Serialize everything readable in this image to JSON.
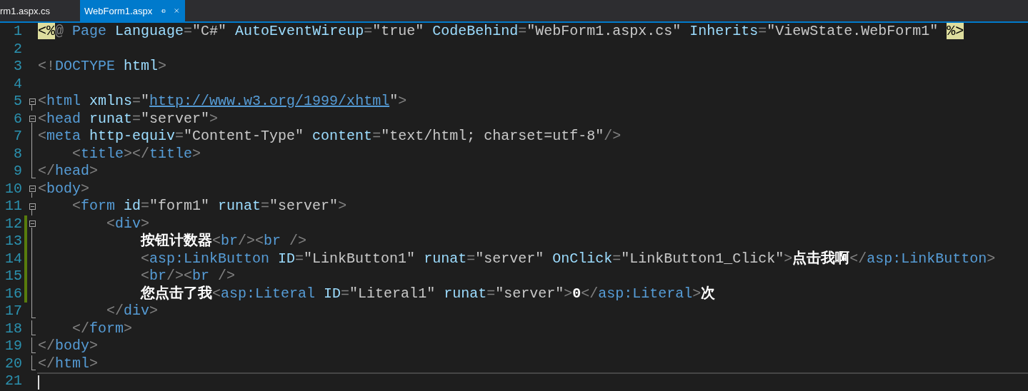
{
  "tabs": [
    {
      "label": "rm1.aspx.cs",
      "selected": false
    },
    {
      "label": "WebForm1.aspx",
      "selected": true
    }
  ],
  "lines": [
    {
      "number": "1",
      "kind": "none",
      "changed": false,
      "current": false,
      "tokens": [
        {
          "kind": "directive",
          "text": "<%"
        },
        {
          "kind": "punct",
          "text": "@"
        },
        {
          "kind": "tag",
          "text": " Page"
        },
        {
          "kind": "attr",
          "text": " Language"
        },
        {
          "kind": "punct",
          "text": "="
        },
        {
          "kind": "string",
          "text": "\"C#\""
        },
        {
          "kind": "attr",
          "text": " AutoEventWireup"
        },
        {
          "kind": "punct",
          "text": "="
        },
        {
          "kind": "string",
          "text": "\"true\""
        },
        {
          "kind": "attr",
          "text": " CodeBehind"
        },
        {
          "kind": "punct",
          "text": "="
        },
        {
          "kind": "string",
          "text": "\"WebForm1.aspx.cs\""
        },
        {
          "kind": "attr",
          "text": " Inherits"
        },
        {
          "kind": "punct",
          "text": "="
        },
        {
          "kind": "string",
          "text": "\"ViewState.WebForm1\" "
        },
        {
          "kind": "directive",
          "text": "%>"
        }
      ]
    },
    {
      "number": "2",
      "kind": "none",
      "changed": false,
      "current": false
    },
    {
      "number": "3",
      "kind": "none",
      "changed": false,
      "current": false,
      "tokens": [
        {
          "kind": "punct",
          "text": "<!"
        },
        {
          "kind": "tag",
          "text": "DOCTYPE"
        },
        {
          "kind": "attr",
          "text": " html"
        },
        {
          "kind": "punct",
          "text": ">"
        }
      ]
    },
    {
      "number": "4",
      "kind": "none",
      "changed": false,
      "current": false
    },
    {
      "number": "5",
      "kind": "start",
      "changed": false,
      "current": false,
      "tokens": [
        {
          "kind": "punct",
          "text": "<"
        },
        {
          "kind": "tag",
          "text": "html"
        },
        {
          "kind": "attr",
          "text": " xmlns"
        },
        {
          "kind": "punct",
          "text": "="
        },
        {
          "kind": "string",
          "text": "\""
        },
        {
          "kind": "url",
          "text": "http://www.w3.org/1999/xhtml"
        },
        {
          "kind": "string",
          "text": "\""
        },
        {
          "kind": "punct",
          "text": ">"
        }
      ]
    },
    {
      "number": "6",
      "kind": "start",
      "changed": false,
      "current": false,
      "tokens": [
        {
          "kind": "punct",
          "text": "<"
        },
        {
          "kind": "tag",
          "text": "head"
        },
        {
          "kind": "attr",
          "text": " runat"
        },
        {
          "kind": "punct",
          "text": "="
        },
        {
          "kind": "string",
          "text": "\"server\""
        },
        {
          "kind": "punct",
          "text": ">"
        }
      ]
    },
    {
      "number": "7",
      "kind": "middle",
      "changed": false,
      "current": false,
      "tokens": [
        {
          "kind": "punct",
          "text": "<"
        },
        {
          "kind": "tag",
          "text": "meta"
        },
        {
          "kind": "attr",
          "text": " http-equiv"
        },
        {
          "kind": "punct",
          "text": "="
        },
        {
          "kind": "string",
          "text": "\"Content-Type\""
        },
        {
          "kind": "attr",
          "text": " content"
        },
        {
          "kind": "punct",
          "text": "="
        },
        {
          "kind": "string",
          "text": "\"text/html; charset=utf-8\""
        },
        {
          "kind": "punct",
          "text": "/>"
        }
      ]
    },
    {
      "number": "8",
      "kind": "middle",
      "changed": false,
      "current": false,
      "tokens": [
        {
          "kind": "punct",
          "text": "    <"
        },
        {
          "kind": "tag",
          "text": "title"
        },
        {
          "kind": "punct",
          "text": "></"
        },
        {
          "kind": "tag",
          "text": "title"
        },
        {
          "kind": "punct",
          "text": ">"
        }
      ]
    },
    {
      "number": "9",
      "kind": "end",
      "changed": false,
      "current": false,
      "tokens": [
        {
          "kind": "punct",
          "text": "</"
        },
        {
          "kind": "tag",
          "text": "head"
        },
        {
          "kind": "punct",
          "text": ">"
        }
      ]
    },
    {
      "number": "10",
      "kind": "start",
      "changed": false,
      "current": false,
      "tokens": [
        {
          "kind": "punct",
          "text": "<"
        },
        {
          "kind": "tag",
          "text": "body"
        },
        {
          "kind": "punct",
          "text": ">"
        }
      ]
    },
    {
      "number": "11",
      "kind": "start",
      "changed": false,
      "current": false,
      "tokens": [
        {
          "kind": "punct",
          "text": "    <"
        },
        {
          "kind": "tag",
          "text": "form"
        },
        {
          "kind": "attr",
          "text": " id"
        },
        {
          "kind": "punct",
          "text": "="
        },
        {
          "kind": "string",
          "text": "\"form1\""
        },
        {
          "kind": "attr",
          "text": " runat"
        },
        {
          "kind": "punct",
          "text": "="
        },
        {
          "kind": "string",
          "text": "\"server\""
        },
        {
          "kind": "punct",
          "text": ">"
        }
      ]
    },
    {
      "number": "12",
      "kind": "start",
      "changed": true,
      "current": false,
      "tokens": [
        {
          "kind": "punct",
          "text": "        <"
        },
        {
          "kind": "tag",
          "text": "div"
        },
        {
          "kind": "punct",
          "text": ">"
        }
      ]
    },
    {
      "number": "13",
      "kind": "middle",
      "changed": true,
      "current": false,
      "tokens": [
        {
          "kind": "text",
          "text": "            按钮计数器"
        },
        {
          "kind": "punct",
          "text": "<"
        },
        {
          "kind": "tag",
          "text": "br"
        },
        {
          "kind": "punct",
          "text": "/><"
        },
        {
          "kind": "tag",
          "text": "br"
        },
        {
          "kind": "punct",
          "text": " />"
        }
      ]
    },
    {
      "number": "14",
      "kind": "middle",
      "changed": true,
      "current": false,
      "tokens": [
        {
          "kind": "punct",
          "text": "            <"
        },
        {
          "kind": "tag",
          "text": "asp:LinkButton"
        },
        {
          "kind": "attr",
          "text": " ID"
        },
        {
          "kind": "punct",
          "text": "="
        },
        {
          "kind": "string",
          "text": "\"LinkButton1\""
        },
        {
          "kind": "attr",
          "text": " runat"
        },
        {
          "kind": "punct",
          "text": "="
        },
        {
          "kind": "string",
          "text": "\"server\""
        },
        {
          "kind": "attr",
          "text": " OnClick"
        },
        {
          "kind": "punct",
          "text": "="
        },
        {
          "kind": "string",
          "text": "\"LinkButton1_Click\""
        },
        {
          "kind": "punct",
          "text": ">"
        },
        {
          "kind": "text",
          "text": "点击我啊"
        },
        {
          "kind": "punct",
          "text": "</"
        },
        {
          "kind": "tag",
          "text": "asp:LinkButton"
        },
        {
          "kind": "punct",
          "text": ">"
        }
      ]
    },
    {
      "number": "15",
      "kind": "middle",
      "changed": true,
      "current": false,
      "tokens": [
        {
          "kind": "punct",
          "text": "            <"
        },
        {
          "kind": "tag",
          "text": "br"
        },
        {
          "kind": "punct",
          "text": "/><"
        },
        {
          "kind": "tag",
          "text": "br"
        },
        {
          "kind": "punct",
          "text": " />"
        }
      ]
    },
    {
      "number": "16",
      "kind": "middle",
      "changed": true,
      "current": false,
      "tokens": [
        {
          "kind": "text",
          "text": "            您点击了我"
        },
        {
          "kind": "punct",
          "text": "<"
        },
        {
          "kind": "tag",
          "text": "asp:Literal"
        },
        {
          "kind": "attr",
          "text": " ID"
        },
        {
          "kind": "punct",
          "text": "="
        },
        {
          "kind": "string",
          "text": "\"Literal1\""
        },
        {
          "kind": "attr",
          "text": " runat"
        },
        {
          "kind": "punct",
          "text": "="
        },
        {
          "kind": "string",
          "text": "\"server\""
        },
        {
          "kind": "punct",
          "text": ">"
        },
        {
          "kind": "text",
          "text": "0"
        },
        {
          "kind": "punct",
          "text": "</"
        },
        {
          "kind": "tag",
          "text": "asp:Literal"
        },
        {
          "kind": "punct",
          "text": ">"
        },
        {
          "kind": "text",
          "text": "次"
        }
      ]
    },
    {
      "number": "17",
      "kind": "end",
      "changed": false,
      "current": false,
      "tokens": [
        {
          "kind": "punct",
          "text": "        </"
        },
        {
          "kind": "tag",
          "text": "div"
        },
        {
          "kind": "punct",
          "text": ">"
        }
      ]
    },
    {
      "number": "18",
      "kind": "end",
      "changed": false,
      "current": false,
      "tokens": [
        {
          "kind": "punct",
          "text": "    </"
        },
        {
          "kind": "tag",
          "text": "form"
        },
        {
          "kind": "punct",
          "text": ">"
        }
      ]
    },
    {
      "number": "19",
      "kind": "end",
      "changed": false,
      "current": false,
      "tokens": [
        {
          "kind": "punct",
          "text": "</"
        },
        {
          "kind": "tag",
          "text": "body"
        },
        {
          "kind": "punct",
          "text": ">"
        }
      ]
    },
    {
      "number": "20",
      "kind": "end",
      "changed": false,
      "current": false,
      "tokens": [
        {
          "kind": "punct",
          "text": "</"
        },
        {
          "kind": "tag",
          "text": "html"
        },
        {
          "kind": "punct",
          "text": ">"
        }
      ]
    },
    {
      "number": "21",
      "kind": "none",
      "changed": false,
      "current": true
    }
  ]
}
